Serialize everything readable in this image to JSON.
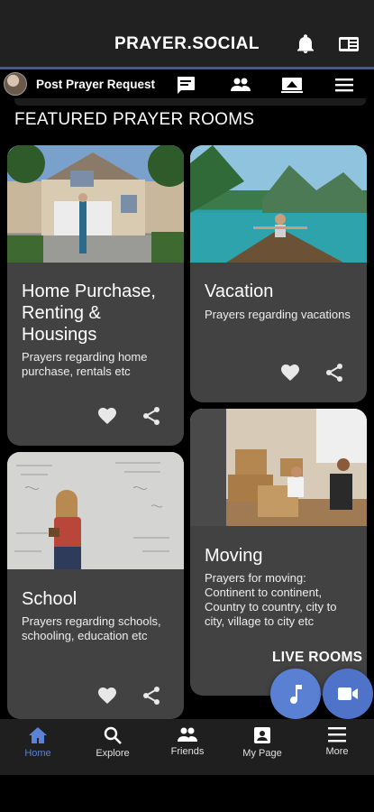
{
  "header": {
    "title": "PRAYER.SOCIAL",
    "icons": [
      "bell-icon",
      "panel-icon"
    ]
  },
  "subbar": {
    "post_label": "Post Prayer Request",
    "icons": [
      "chat-icon",
      "people-icon",
      "cast-icon",
      "menu-icon"
    ]
  },
  "section_title": "FEATURED PRAYER ROOMS",
  "cards": [
    {
      "title": "Home Purchase, Renting & Housings",
      "desc": "Prayers regarding home purchase, rentals etc"
    },
    {
      "title": "Vacation",
      "desc": "Prayers regarding vacations"
    },
    {
      "title": "School",
      "desc": "Prayers regarding schools, schooling, education etc"
    },
    {
      "title": "Moving",
      "desc": "Prayers for moving: Continent to continent, Country to country,  city to city, village to city etc"
    }
  ],
  "live_rooms_label": "LIVE ROOMS",
  "nav": [
    {
      "label": "Home",
      "icon": "home-icon",
      "active": true
    },
    {
      "label": "Explore",
      "icon": "search-icon",
      "active": false
    },
    {
      "label": "Friends",
      "icon": "people-icon",
      "active": false
    },
    {
      "label": "My Page",
      "icon": "profile-card-icon",
      "active": false
    },
    {
      "label": "More",
      "icon": "menu-icon",
      "active": false
    }
  ],
  "colors": {
    "accent": "#4e73c8",
    "card": "#424242",
    "header": "#212121"
  }
}
